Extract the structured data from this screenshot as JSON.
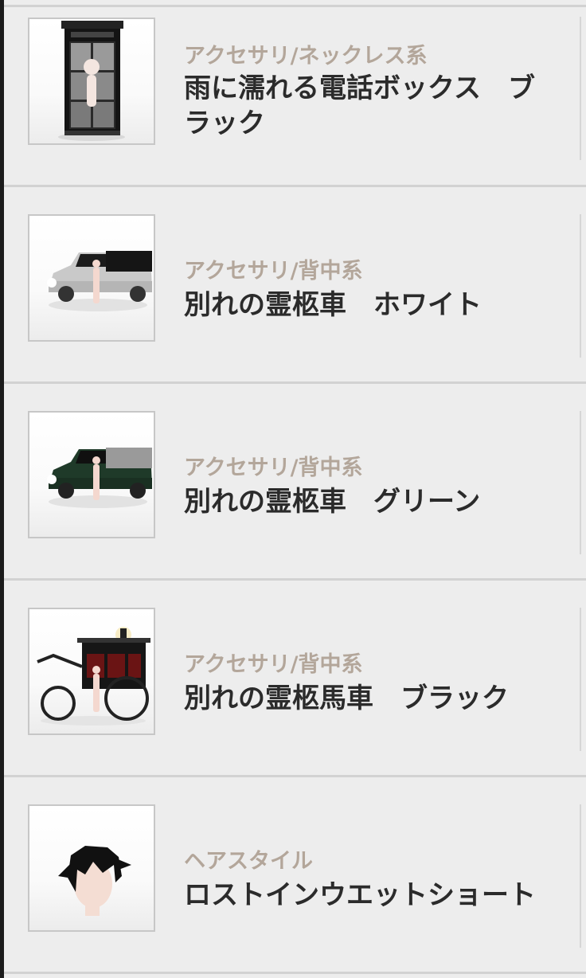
{
  "items": [
    {
      "category": "アクセサリ/ネックレス系",
      "title": "雨に濡れる電話ボックス　ブラック",
      "icon": "phone-booth-image"
    },
    {
      "category": "アクセサリ/背中系",
      "title": "別れの霊柩車　ホワイト",
      "icon": "white-hearse-image"
    },
    {
      "category": "アクセサリ/背中系",
      "title": "別れの霊柩車　グリーン",
      "icon": "green-hearse-image"
    },
    {
      "category": "アクセサリ/背中系",
      "title": "別れの霊柩馬車　ブラック",
      "icon": "black-carriage-image"
    },
    {
      "category": "ヘアスタイル",
      "title": "ロストインウエットショート",
      "icon": "hairstyle-image"
    }
  ]
}
